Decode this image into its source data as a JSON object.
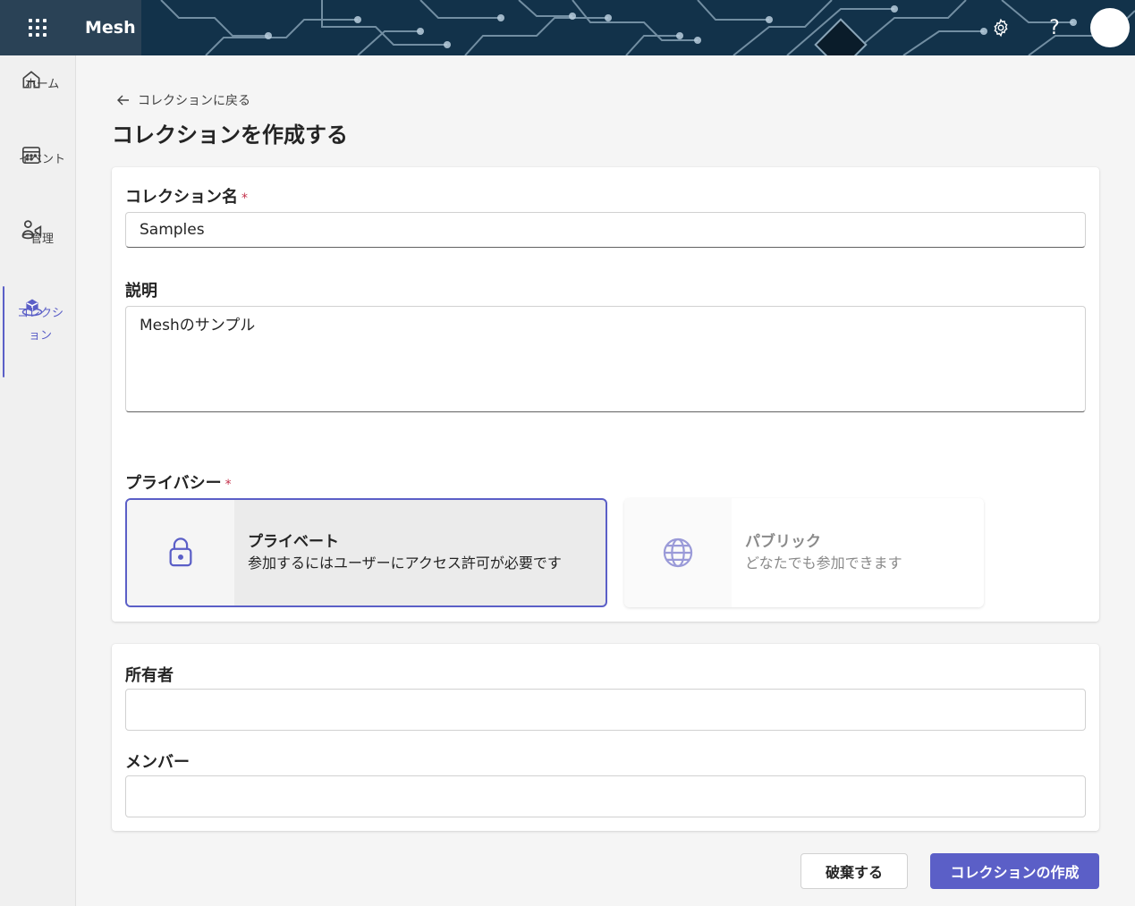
{
  "app": {
    "title": "Mesh"
  },
  "topbar": {
    "settings_icon": "gear-icon",
    "help_icon": "help-icon",
    "help_glyph": "?"
  },
  "rail": {
    "items": [
      {
        "label": "ホーム",
        "icon": "home-icon"
      },
      {
        "label": "イベント",
        "icon": "calendar-icon"
      },
      {
        "label": "管理",
        "icon": "manage-icon"
      },
      {
        "label": "コレクション",
        "icon": "collection-icon",
        "active": true
      }
    ]
  },
  "nav": {
    "back_label": "コレクションに戻る"
  },
  "page": {
    "title": "コレクションを作成する"
  },
  "form": {
    "name_label": "コレクション名",
    "name_value": "Samples",
    "required_mark": "*",
    "description_label": "説明",
    "description_value": "Meshのサンプル",
    "privacy_label": "プライバシー",
    "privacy_options": [
      {
        "title": "プライベート",
        "description": "参加するにはユーザーにアクセス許可が必要です",
        "icon": "lock-icon",
        "selected": true
      },
      {
        "title": "パブリック",
        "description": "どなたでも参加できます",
        "icon": "globe-icon",
        "selected": false
      }
    ],
    "owner_label": "所有者",
    "owner_value": "",
    "members_label": "メンバー",
    "members_value": ""
  },
  "actions": {
    "discard_label": "破棄する",
    "create_label": "コレクションの作成"
  },
  "colors": {
    "accent": "#5b5fc7",
    "required": "#c4314b",
    "header_dark": "#0f2a3d"
  }
}
